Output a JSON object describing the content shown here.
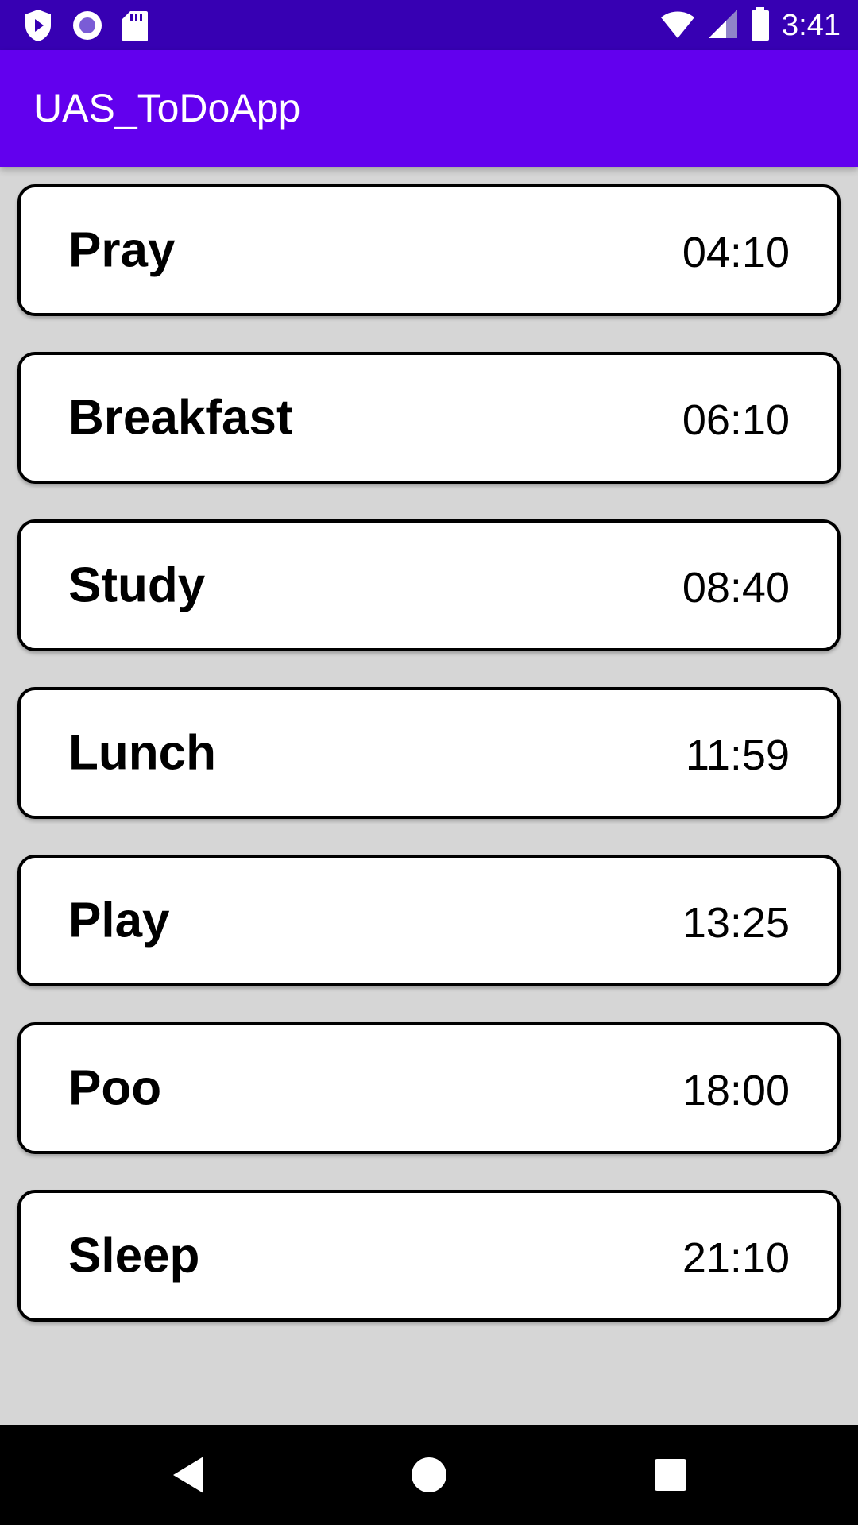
{
  "status_bar": {
    "time": "3:41",
    "icons_left": [
      "play-protect-icon",
      "record-icon",
      "sd-card-icon"
    ],
    "icons_right": [
      "wifi-icon",
      "signal-icon",
      "battery-icon"
    ]
  },
  "app_bar": {
    "title": "UAS_ToDoApp"
  },
  "tasks": [
    {
      "name": "Pray",
      "time": "04:10"
    },
    {
      "name": "Breakfast",
      "time": "06:10"
    },
    {
      "name": "Study",
      "time": "08:40"
    },
    {
      "name": "Lunch",
      "time": "11:59"
    },
    {
      "name": "Play",
      "time": "13:25"
    },
    {
      "name": "Poo",
      "time": "18:00"
    },
    {
      "name": "Sleep",
      "time": "21:10"
    }
  ],
  "nav_bar": {
    "buttons": [
      "back-icon",
      "home-icon",
      "recents-icon"
    ]
  },
  "colors": {
    "status_bar": "#3700b3",
    "app_bar": "#6200ee",
    "background": "#d6d6d6",
    "card": "#ffffff",
    "nav_bar": "#000000"
  }
}
